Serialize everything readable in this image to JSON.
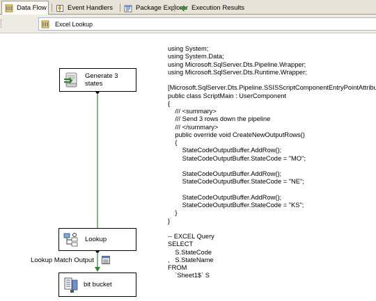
{
  "tabs": [
    {
      "label": "Data Flow",
      "icon": "data-flow-icon",
      "active": true
    },
    {
      "label": "Event Handlers",
      "icon": "event-handlers-icon",
      "active": false
    },
    {
      "label": "Package Explorer",
      "icon": "package-explorer-icon",
      "active": false
    },
    {
      "label": "Execution Results",
      "icon": "execution-results-icon",
      "active": false
    }
  ],
  "task_selector": {
    "value": "Excel Lookup",
    "icon": "data-flow-task-icon"
  },
  "components": {
    "generate": {
      "label": "Generate 3 states",
      "icon": "script-component-icon"
    },
    "lookup": {
      "label": "Lookup",
      "icon": "lookup-icon"
    },
    "bit_bucket": {
      "label": "bit bucket",
      "icon": "destination-icon"
    }
  },
  "path": {
    "label": "Lookup Match Output",
    "viewer_icon": "data-viewer-icon"
  },
  "code_lines": [
    "using System;",
    "using System.Data;",
    "using Microsoft.SqlServer.Dts.Pipeline.Wrapper;",
    "using Microsoft.SqlServer.Dts.Runtime.Wrapper;",
    "",
    "[Microsoft.SqlServer.Dts.Pipeline.SSISScriptComponentEntryPointAttribute]",
    "public class ScriptMain : UserComponent",
    "{",
    "    /// <summary>",
    "    /// Send 3 rows down the pipeline",
    "    /// </summary>",
    "    public override void CreateNewOutputRows()",
    "    {",
    "        StateCodeOutputBuffer.AddRow();",
    "        StateCodeOutputBuffer.StateCode = \"MO\";",
    "",
    "        StateCodeOutputBuffer.AddRow();",
    "        StateCodeOutputBuffer.StateCode = \"NE\";",
    "",
    "        StateCodeOutputBuffer.AddRow();",
    "        StateCodeOutputBuffer.StateCode = \"KS\";",
    "    }",
    "}",
    "",
    "-- EXCEL Query",
    "SELECT",
    "    S.StateCode",
    ",   S.StateName",
    "FROM",
    "    `Sheet1$` S"
  ],
  "colors": {
    "connector": "#2a8a2a",
    "tab_bg": "#e7e3d8",
    "active_tab_bg": "#fbfaf6",
    "selector_border": "#a9b8cf"
  }
}
